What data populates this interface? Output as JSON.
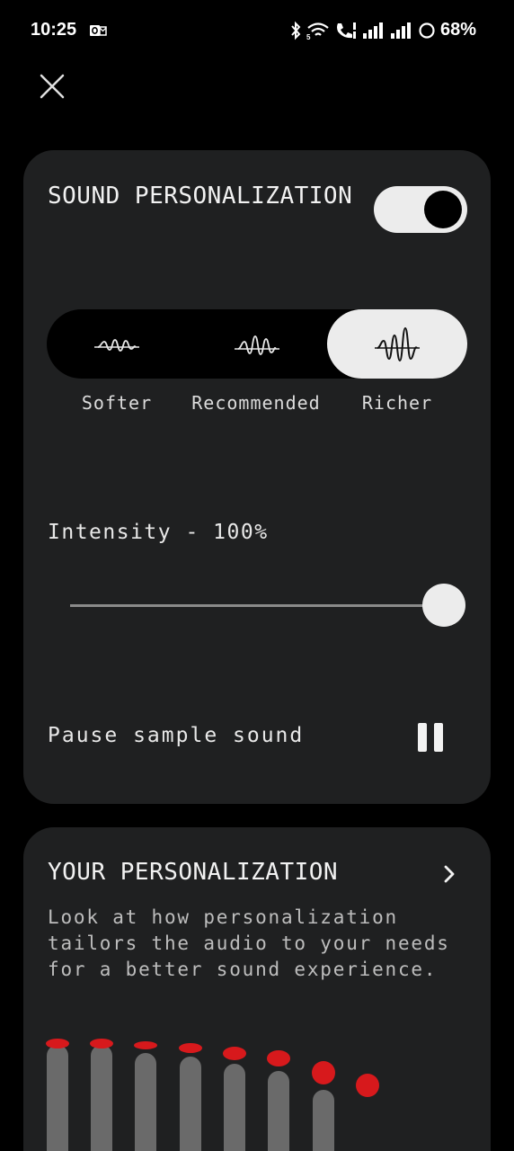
{
  "status_bar": {
    "time": "10:25",
    "battery": "68%",
    "icons": [
      "outlook-icon",
      "bluetooth-icon",
      "wifi-icon",
      "call-icon",
      "signal-icon",
      "signal-icon",
      "battery-icon"
    ]
  },
  "header": {
    "close_icon": "close-icon"
  },
  "sound_card": {
    "title": "SOUND PERSONALIZATION",
    "toggle_on": true,
    "presets": [
      {
        "label": "Softer",
        "icon": "soft-wave-icon"
      },
      {
        "label": "Recommended",
        "icon": "medium-wave-icon"
      },
      {
        "label": "Richer",
        "icon": "rich-wave-icon"
      }
    ],
    "selected_preset": "Richer",
    "intensity_label": "Intensity - 100%",
    "intensity_value": 100,
    "pause_label": "Pause sample sound",
    "pause_icon": "pause-icon"
  },
  "personalization_card": {
    "title": "YOUR PERSONALIZATION",
    "chevron_icon": "chevron-right-icon",
    "description": "Look at how personalization tailors the audio to your needs for a better sound experience."
  },
  "colors": {
    "background": "#000000",
    "card": "#1f2021",
    "accent_red": "#d7191c",
    "bar_gray": "#6a6a6a",
    "light": "#ececec"
  }
}
